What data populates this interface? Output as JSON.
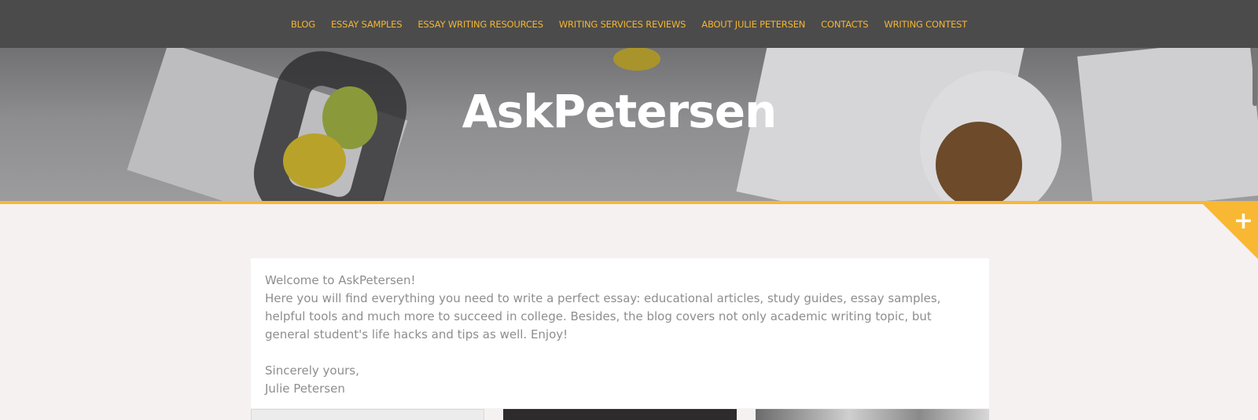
{
  "nav": {
    "items": [
      {
        "label": "BLOG"
      },
      {
        "label": "ESSAY SAMPLES"
      },
      {
        "label": "ESSAY WRITING RESOURCES"
      },
      {
        "label": "WRITING SERVICES REVIEWS"
      },
      {
        "label": "ABOUT JULIE PETERSEN"
      },
      {
        "label": "CONTACTS"
      },
      {
        "label": "WRITING CONTEST"
      }
    ]
  },
  "hero": {
    "site_title": "AskPetersen"
  },
  "colors": {
    "navbar": "#4b4b4b",
    "nav_text": "#f3b534",
    "accent": "#f8b833",
    "body_text": "#8e8e8e",
    "background": "#f6f1f1"
  },
  "corner_toggle": {
    "icon": "plus-icon"
  },
  "intro": {
    "greeting": "Welcome to AskPetersen!",
    "body": "Here you will find everything you need to write a perfect essay: educational articles, study guides, essay samples, helpful tools and much more to succeed in college. Besides, the blog covers not only academic writing topic, but general student's life hacks and tips as well. Enjoy!",
    "closing": "Sincerely yours,",
    "signature": "Julie Petersen"
  }
}
